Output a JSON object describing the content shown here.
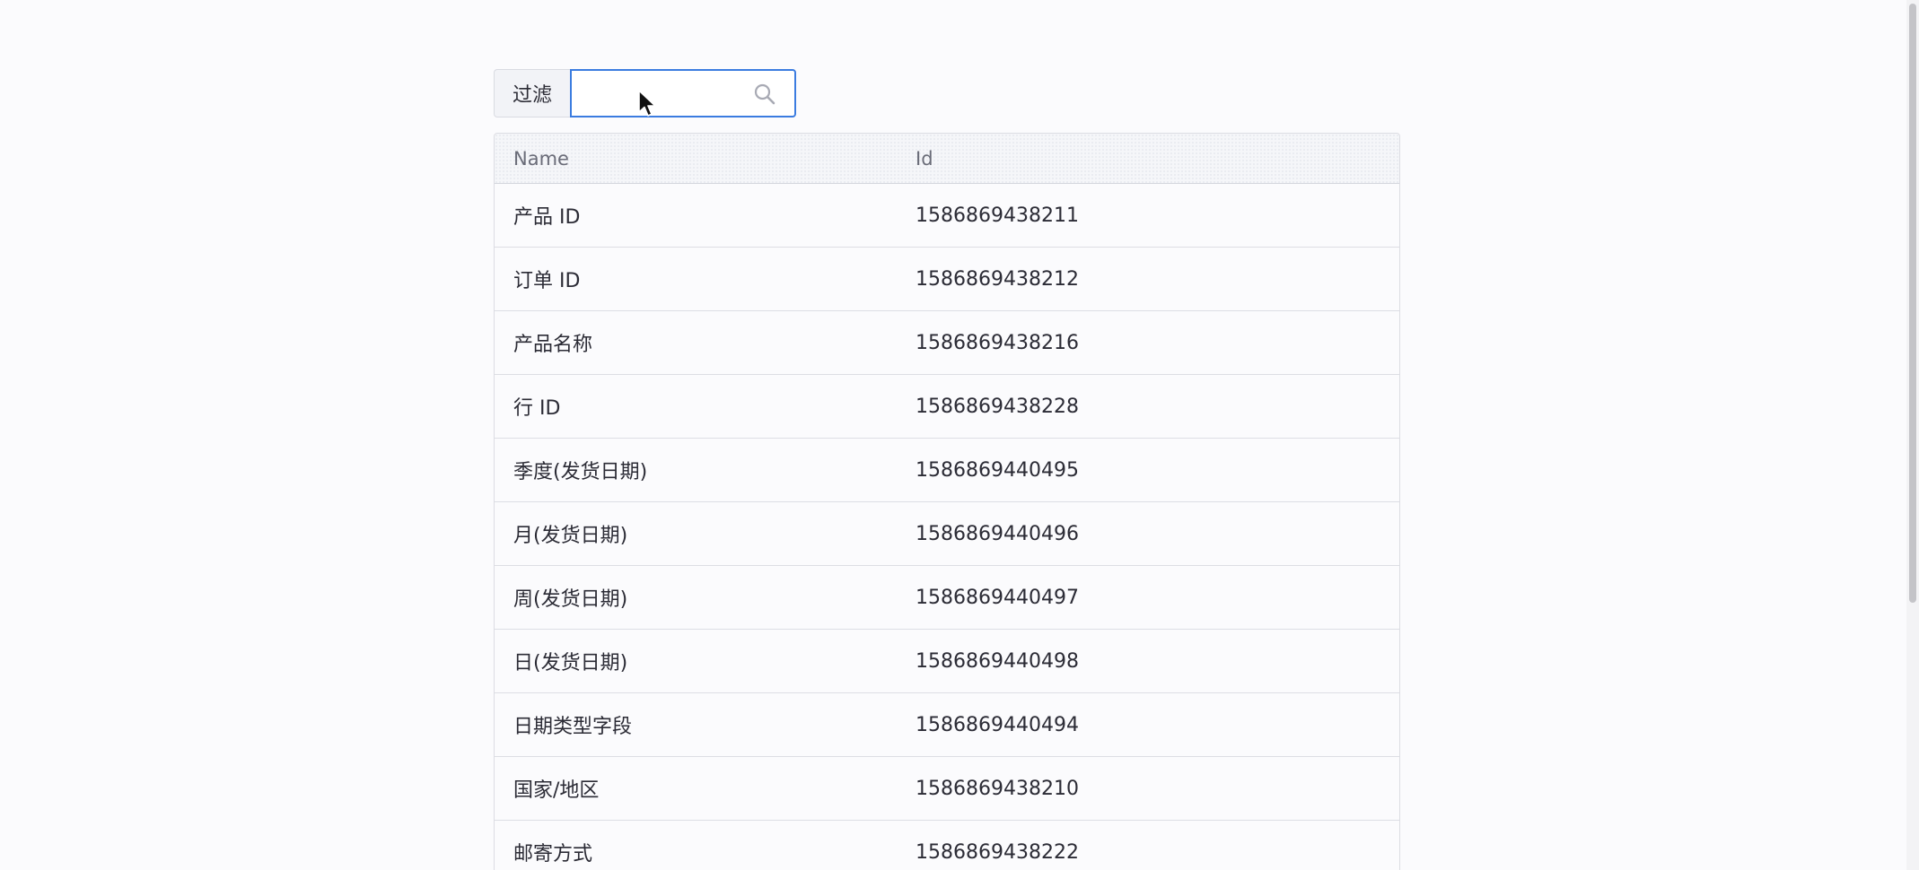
{
  "filter": {
    "label": "过滤",
    "value": "",
    "placeholder": ""
  },
  "table": {
    "headers": {
      "name": "Name",
      "id": "Id"
    },
    "rows": [
      {
        "name": "产品 ID",
        "id": "1586869438211"
      },
      {
        "name": "订单 ID",
        "id": "1586869438212"
      },
      {
        "name": "产品名称",
        "id": "1586869438216"
      },
      {
        "name": "行 ID",
        "id": "1586869438228"
      },
      {
        "name": "季度(发货日期)",
        "id": "1586869440495"
      },
      {
        "name": "月(发货日期)",
        "id": "1586869440496"
      },
      {
        "name": "周(发货日期)",
        "id": "1586869440497"
      },
      {
        "name": "日(发货日期)",
        "id": "1586869440498"
      },
      {
        "name": "日期类型字段",
        "id": "1586869440494"
      },
      {
        "name": "国家/地区",
        "id": "1586869438210"
      },
      {
        "name": "邮寄方式",
        "id": "1586869438222"
      }
    ]
  },
  "icons": {
    "search": "search-icon",
    "cursor": "mouse-cursor-icon"
  },
  "colors": {
    "accent": "#3b7ce0",
    "background": "#fbfbfd",
    "text": "#2b2b35"
  }
}
